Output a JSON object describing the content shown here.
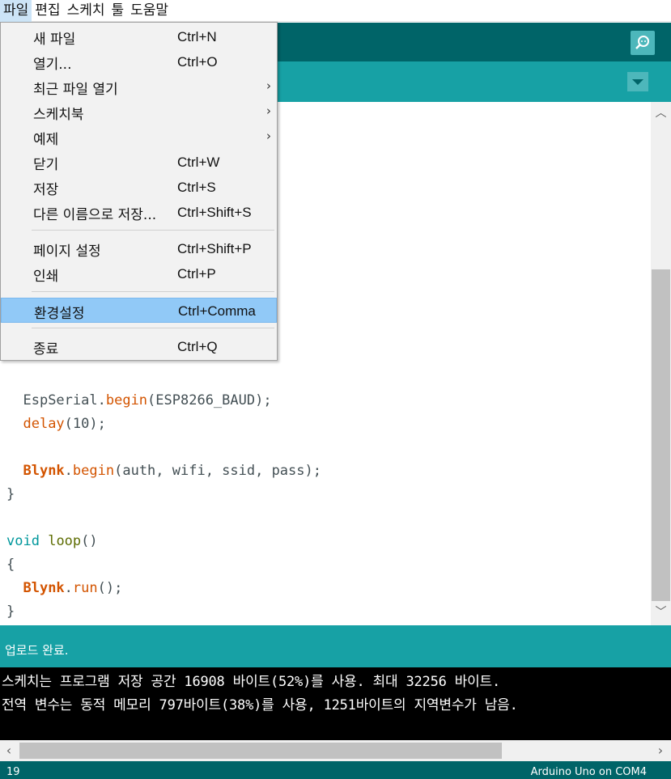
{
  "menubar": [
    "파일",
    "편집",
    "스케치",
    "툴",
    "도움말"
  ],
  "file_menu": {
    "items": [
      {
        "label": "새 파일",
        "shortcut": "Ctrl+N"
      },
      {
        "label": "열기...",
        "shortcut": "Ctrl+O"
      },
      {
        "label": "최근 파일 열기",
        "submenu": "›"
      },
      {
        "label": "스케치북",
        "submenu": "›"
      },
      {
        "label": "예제",
        "submenu": "›"
      },
      {
        "label": "닫기",
        "shortcut": "Ctrl+W"
      },
      {
        "label": "저장",
        "shortcut": "Ctrl+S"
      },
      {
        "label": "다른 이름으로 저장...",
        "shortcut": "Ctrl+Shift+S"
      },
      {
        "label": "페이지 설정",
        "shortcut": "Ctrl+Shift+P"
      },
      {
        "label": "인쇄",
        "shortcut": "Ctrl+P"
      },
      {
        "label": "환경설정",
        "shortcut": "Ctrl+Comma"
      },
      {
        "label": "종료",
        "shortcut": "Ctrl+Q"
      }
    ]
  },
  "code": {
    "line1_obj": "EspSerial",
    "line1_fn": "begin",
    "line1_args": "(ESP8266_BAUD);",
    "line2_fn": "delay",
    "line2_args": "(10);",
    "line3_obj": "Blynk",
    "line3_fn": "begin",
    "line3_args": "(auth, wifi, ssid, pass);",
    "close_brace": "}",
    "void_kw": "void",
    "loop_fn": "loop",
    "loop_parens": "()",
    "open_brace": "{",
    "line4_obj": "Blynk",
    "line4_fn": "run",
    "line4_args": "();",
    "end_brace": "}",
    "dot": "."
  },
  "status": {
    "message": "업로드 완료."
  },
  "console": {
    "lines": [
      "스케치는 프로그램 저장 공간 16908 바이트(52%)를 사용. 최대 32256 바이트.",
      "전역 변수는 동적 메모리 797바이트(38%)를 사용, 1251바이트의 지역변수가 남음."
    ]
  },
  "footer": {
    "line_number": "19",
    "board": "Arduino Uno on COM4"
  },
  "colors": {
    "teal_dark": "#006468",
    "teal": "#17a1a5",
    "highlight": "#91c9f7"
  }
}
